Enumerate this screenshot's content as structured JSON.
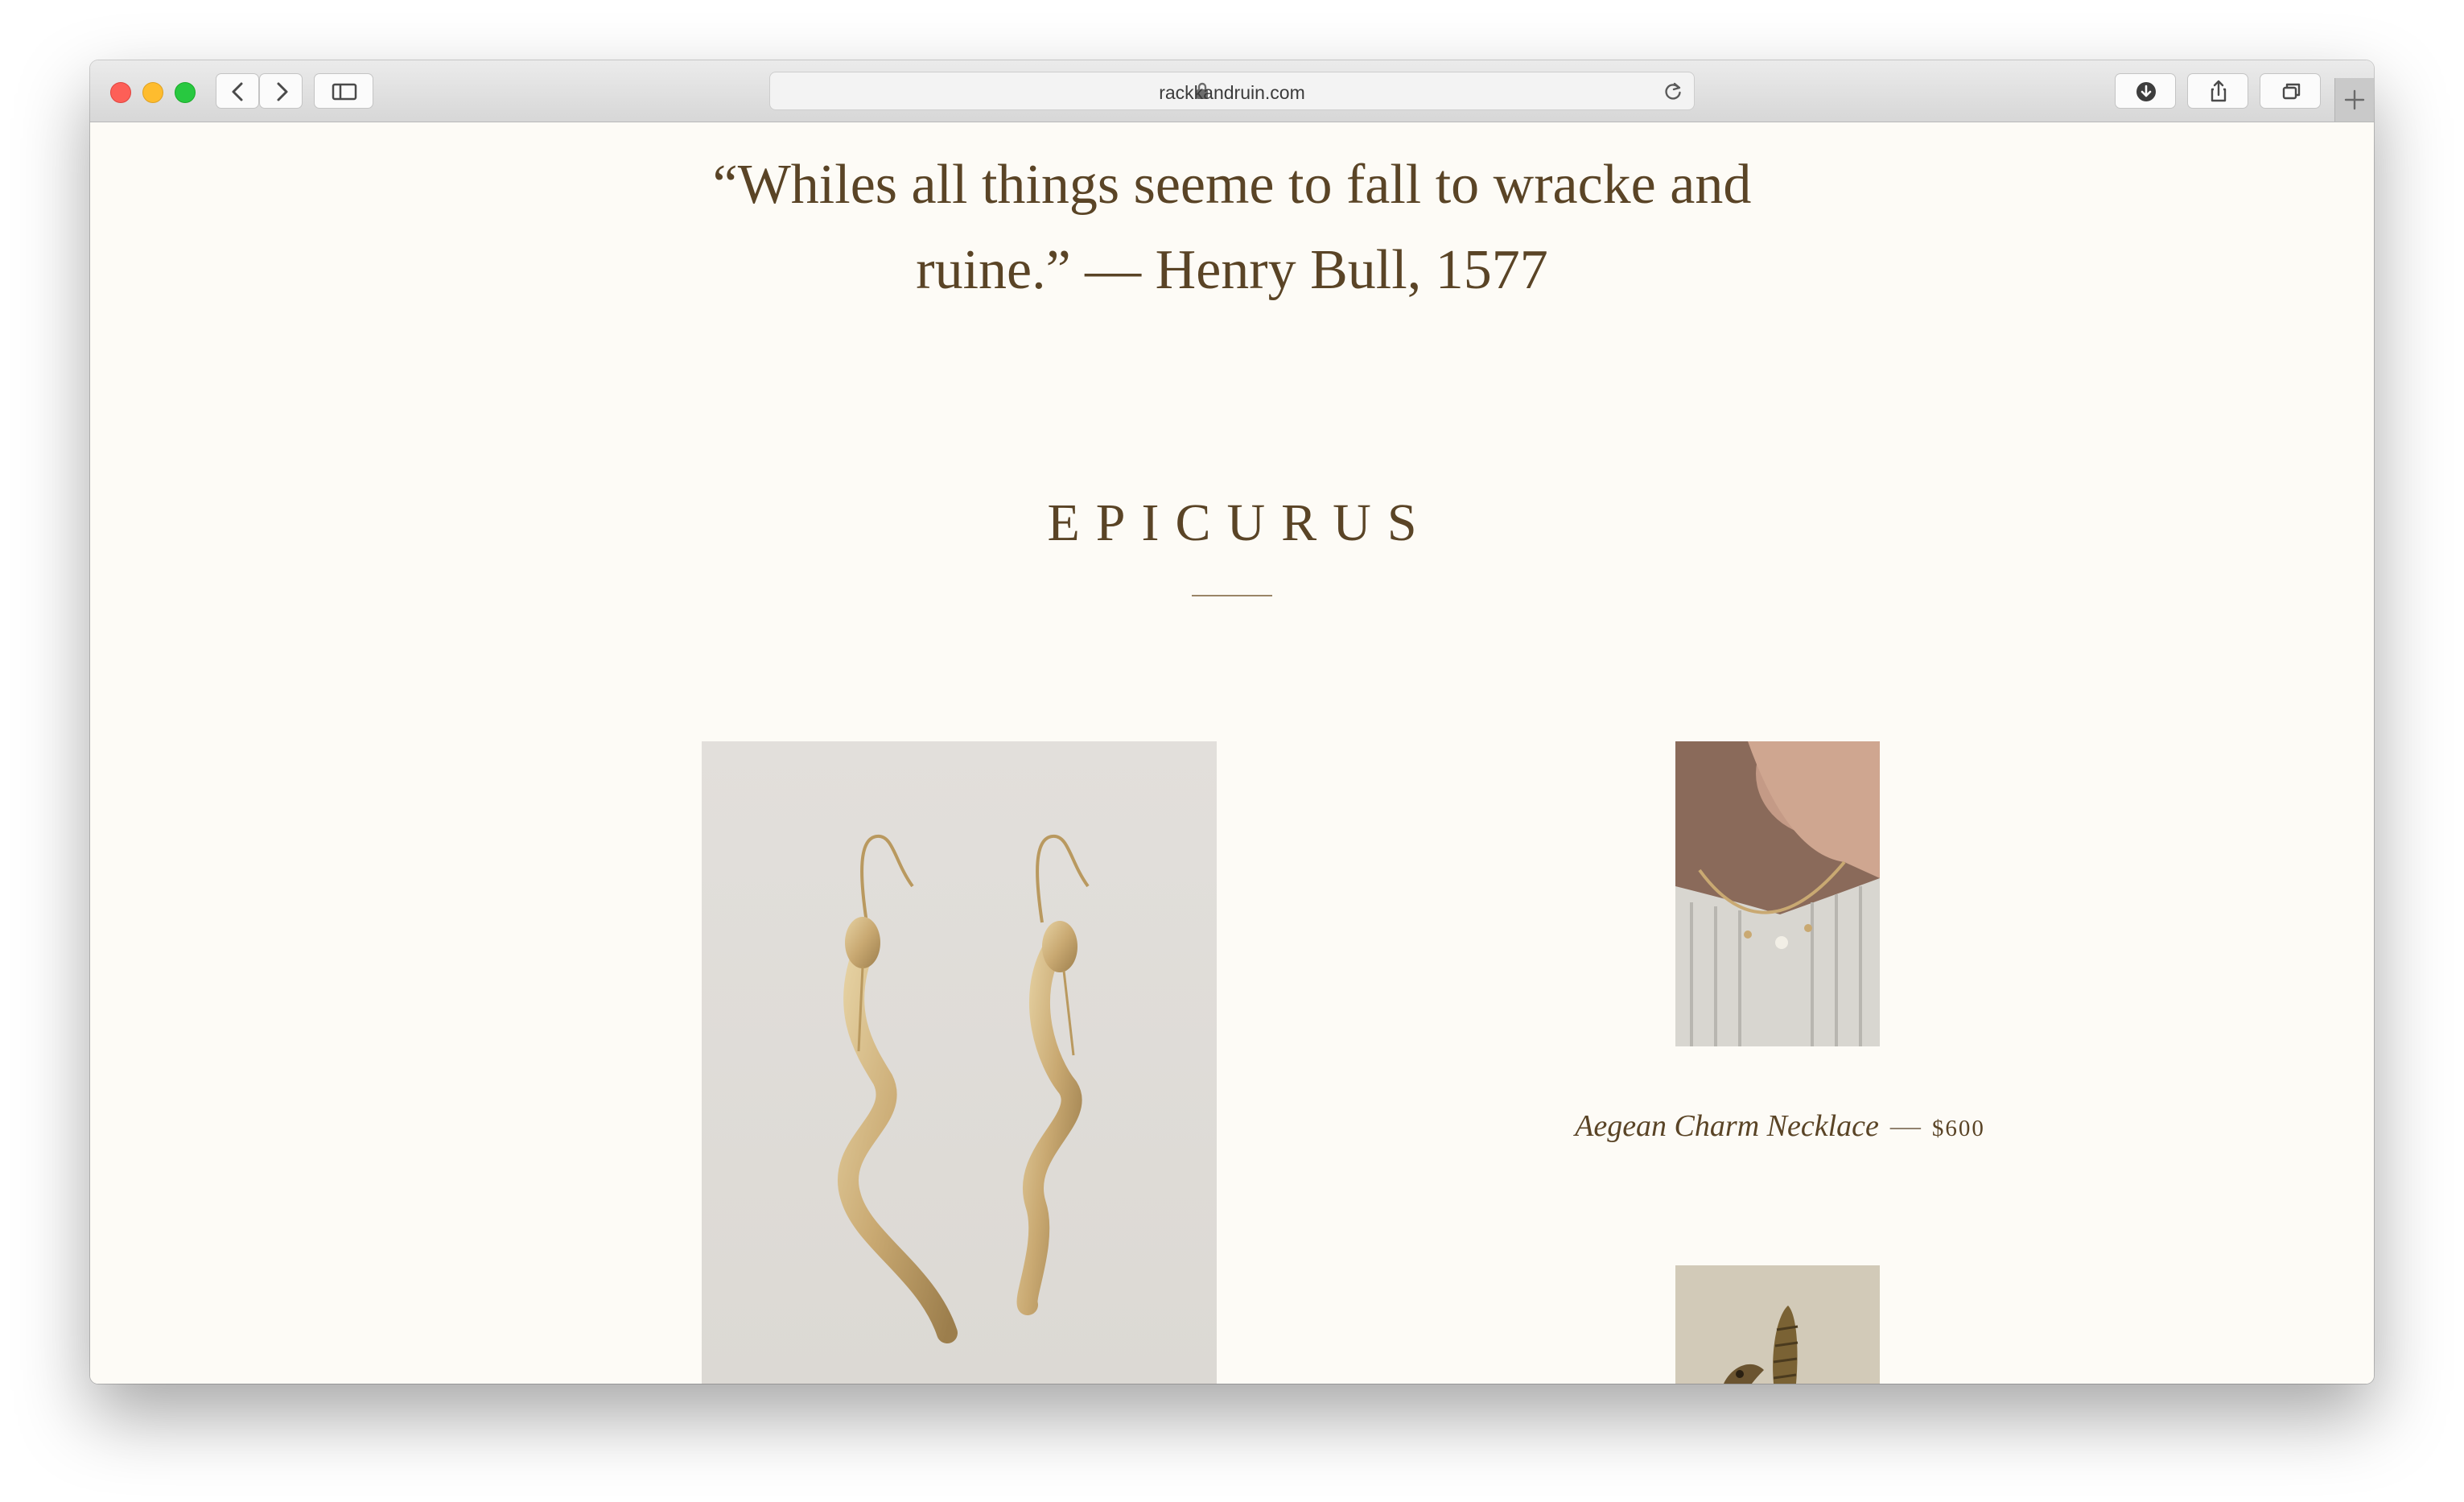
{
  "browser": {
    "url": "rackkandruin.com",
    "icons": [
      "back-icon",
      "forward-icon",
      "sidebar-icon",
      "lock-icon",
      "reload-icon",
      "download-icon",
      "share-icon",
      "tabs-icon",
      "new-tab-icon"
    ]
  },
  "page": {
    "quote": "“Whiles all things seeme to fall to wracke and ruine.” — Henry Bull, 1577",
    "section_title": "EPICURUS",
    "products": [
      {
        "name": "Aegean Charm Necklace",
        "separator": "—",
        "price": "$600"
      }
    ]
  },
  "colors": {
    "page_background": "#fdfbf6",
    "text_brown": "#5a4426",
    "gold": "#c9a972"
  }
}
